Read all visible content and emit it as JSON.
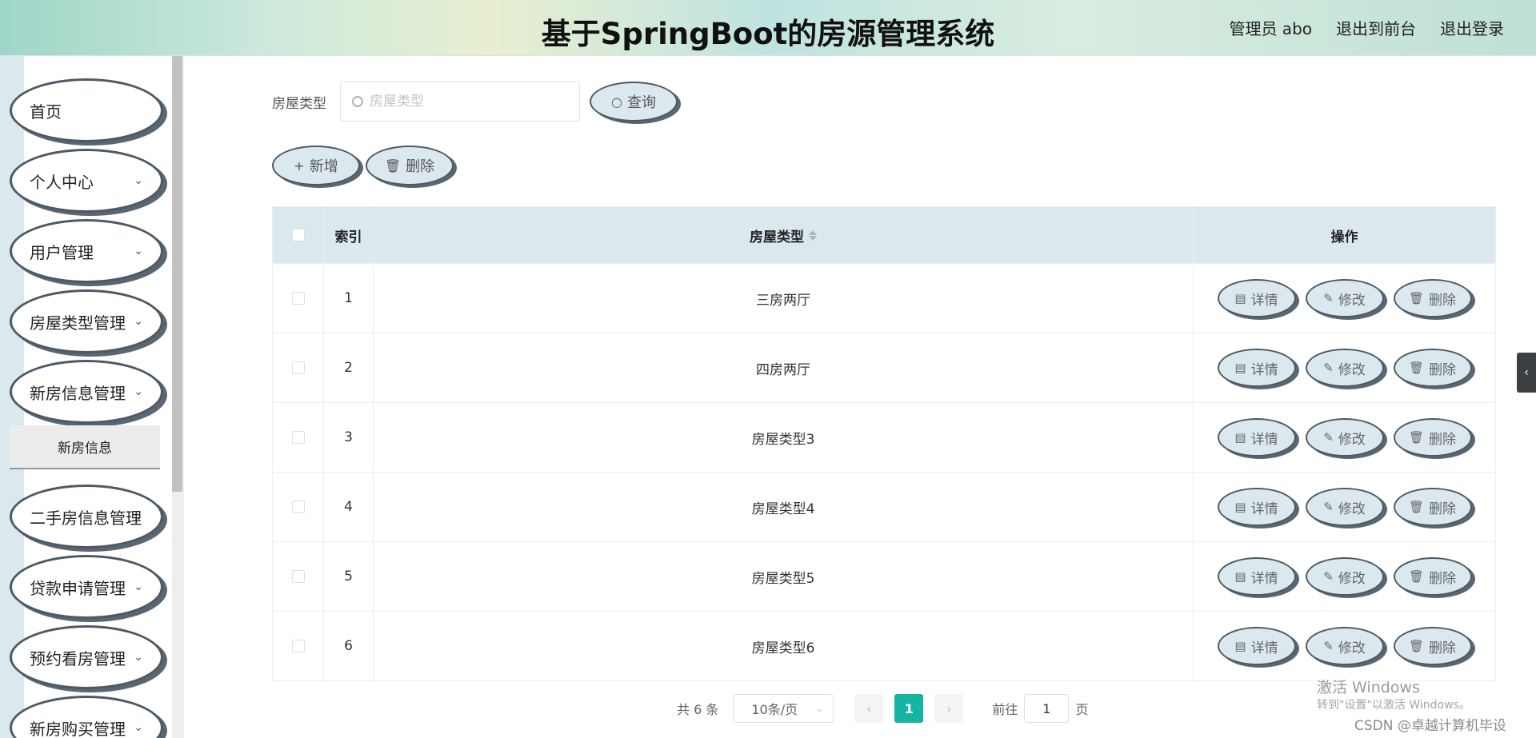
{
  "header": {
    "title": "基于SpringBoot的房源管理系统",
    "user": "管理员 abo",
    "to_front": "退出到前台",
    "logout": "退出登录"
  },
  "sidebar": {
    "items": [
      {
        "label": "首页"
      },
      {
        "label": "个人中心"
      },
      {
        "label": "用户管理"
      },
      {
        "label": "房屋类型管理"
      },
      {
        "label": "新房信息管理"
      },
      {
        "label": "二手房信息管理"
      },
      {
        "label": "贷款申请管理"
      },
      {
        "label": "预约看房管理"
      },
      {
        "label": "新房购买管理"
      }
    ],
    "submenu": {
      "label": "新房信息"
    }
  },
  "search": {
    "label": "房屋类型",
    "placeholder": "房屋类型",
    "value": "",
    "button": "查询"
  },
  "toolbar": {
    "add": "新增",
    "delete": "删除"
  },
  "table": {
    "headers": {
      "index": "索引",
      "type": "房屋类型",
      "ops": "操作"
    },
    "rows": [
      {
        "index": "1",
        "type": "三房两厅"
      },
      {
        "index": "2",
        "type": "四房两厅"
      },
      {
        "index": "3",
        "type": "房屋类型3"
      },
      {
        "index": "4",
        "type": "房屋类型4"
      },
      {
        "index": "5",
        "type": "房屋类型5"
      },
      {
        "index": "6",
        "type": "房屋类型6"
      }
    ],
    "row_actions": {
      "detail": "详情",
      "edit": "修改",
      "delete": "删除"
    }
  },
  "pagination": {
    "total": "共 6 条",
    "page_size": "10条/页",
    "current": "1",
    "goto_prefix": "前往",
    "goto_value": "1",
    "goto_suffix": "页"
  },
  "watermark": {
    "line1": "激活 Windows",
    "line2": "转到\"设置\"以激活 Windows。",
    "line3": "CSDN @卓越计算机毕设"
  },
  "colors": {
    "accent": "#17b3a3",
    "button_fill": "#dbe9ee",
    "button_border": "#4d5a66",
    "header_row": "#dbe9ee"
  }
}
